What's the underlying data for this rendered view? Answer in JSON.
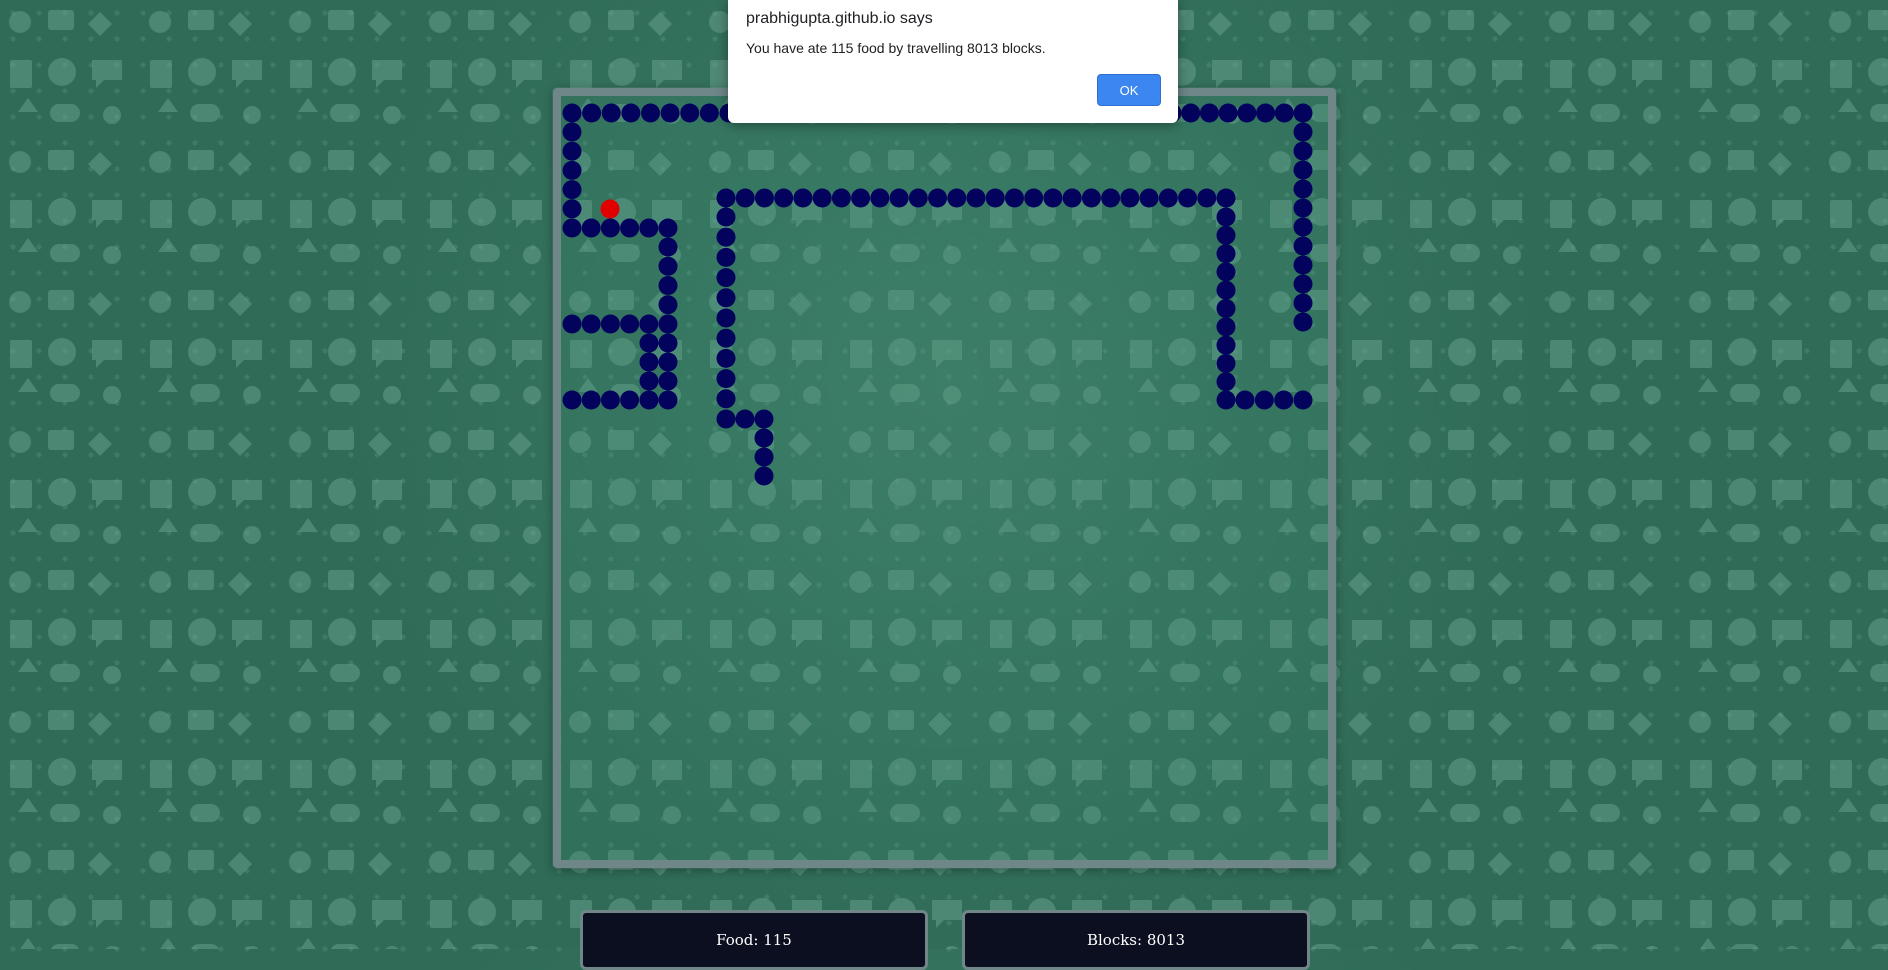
{
  "alert": {
    "title": "prabhigupta.github.io says",
    "message": "You have ate 115 food by travelling 8013 blocks.",
    "ok_label": "OK"
  },
  "stats": {
    "food_label": "Food: 115",
    "blocks_label": "Blocks: 8013"
  },
  "game": {
    "score_food": 115,
    "blocks_travelled": 8013,
    "snake_color": "#03035e",
    "food_color": "#e00000",
    "board_border_color": "#6f8789"
  }
}
